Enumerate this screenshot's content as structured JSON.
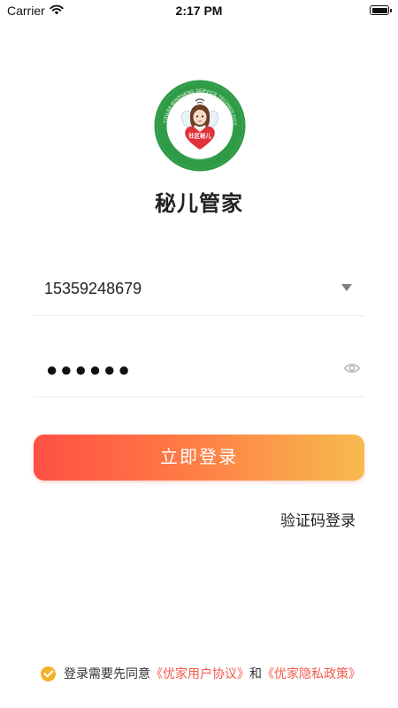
{
  "status_bar": {
    "carrier": "Carrier",
    "time": "2:17 PM",
    "battery_level": 1.0
  },
  "logo": {
    "ring_text_top": "JIANGSU YOUJIA MINSHENG SERVICE TECHNOLOGY CO.,LTD",
    "ring_text_bottom": "江苏优家民生服务科技有限公司",
    "heart_text": "社区秘儿",
    "ring_color": "#2f9b46",
    "heart_color": "#e0323a"
  },
  "app_title": "秘儿管家",
  "login_form": {
    "phone_value": "15359248679",
    "password_value": "●●●●●●",
    "login_button": "立即登录",
    "sms_login_link": "验证码登录"
  },
  "agreement": {
    "checked": true,
    "prefix": "登录需要先同意",
    "user_agreement": "《优家用户协议》",
    "conjunction": "和",
    "privacy_policy": "《优家隐私政策》"
  },
  "colors": {
    "button_gradient_start": "#ff5044",
    "button_gradient_end": "#f7bb4e",
    "link": "#f25a4a",
    "checkbox": "#f3b12a"
  }
}
